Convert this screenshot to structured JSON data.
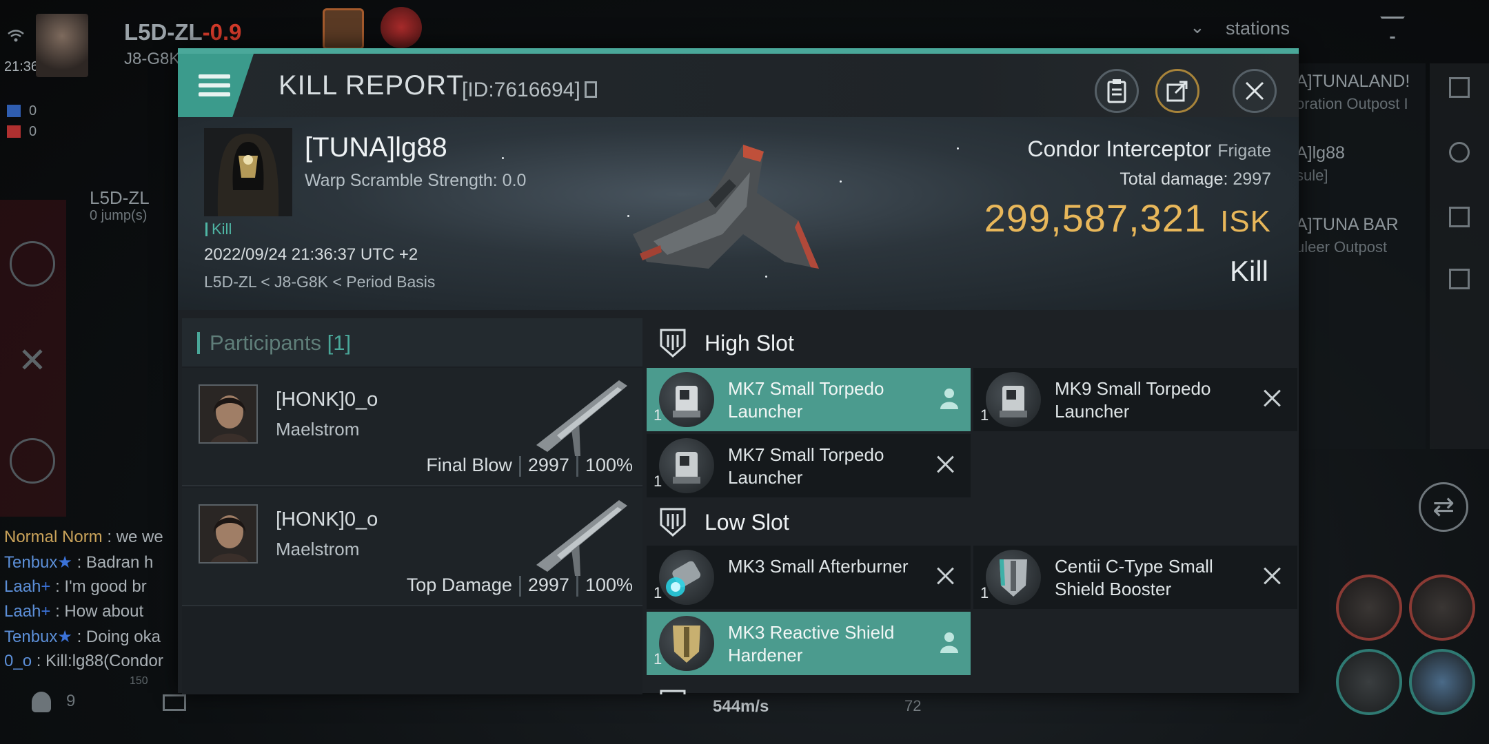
{
  "hud": {
    "system_name": "L5D-ZL",
    "security": "-0.9",
    "constellation": "J8-G8K",
    "time": "21:36",
    "flag_count_blue": "0",
    "flag_count_red": "0",
    "local_system": "L5D-ZL",
    "jumps": "0 jump(s)",
    "stations_label": "stations",
    "nearby_1_title": "A]TUNALAND!",
    "nearby_1_sub": "oration Outpost I",
    "nearby_2_title": "A]lg88",
    "nearby_2_sub": "sule]",
    "nearby_3_title": "A]TUNA BAR",
    "nearby_3_sub": "uleer Outpost",
    "speed": "544m/s",
    "speed_scale": "150",
    "speed_value_2": "72",
    "member_count": "9"
  },
  "chat": [
    {
      "name": "Normal Norm",
      "text": " : we we"
    },
    {
      "name": "Tenbux",
      "badge": "★",
      "text": " : Badran h"
    },
    {
      "name": "Laah",
      "badge": "+",
      "text": " : I'm good br"
    },
    {
      "name": "Laah",
      "badge": "+",
      "text": " : How about "
    },
    {
      "name": "Tenbux",
      "badge": "★",
      "text": " : Doing oka"
    },
    {
      "name": "0_o",
      "text": " : Kill:lg88(Condor"
    }
  ],
  "modal": {
    "title": "KILL REPORT",
    "report_id": "[ID:7616694]",
    "victim": {
      "name": "[TUNA]lg88",
      "warp_scramble": "Warp Scramble Strength: 0.0",
      "tag": "Kill",
      "datetime": "2022/09/24 21:36:37 UTC +2",
      "location": "L5D-ZL < J8-G8K < Period Basis"
    },
    "ship": {
      "name": "Condor Interceptor",
      "class": "Frigate",
      "total_damage_label": "Total damage:",
      "total_damage": "2997",
      "isk_value": "299,587,321",
      "isk_unit": "ISK",
      "result": "Kill"
    },
    "participants": {
      "label": "Participants",
      "count": "[1]",
      "rows": [
        {
          "name": "[HONK]0_o",
          "ship": "Maelstrom",
          "role": "Final Blow",
          "damage": "2997",
          "percent": "100%"
        },
        {
          "name": "[HONK]0_o",
          "ship": "Maelstrom",
          "role": "Top Damage",
          "damage": "2997",
          "percent": "100%"
        }
      ]
    },
    "slots": {
      "high_label": "High Slot",
      "low_label": "Low Slot",
      "high": [
        {
          "name": "MK7 Small Torpedo Launcher",
          "qty": "1",
          "state": "fitted"
        },
        {
          "name": "MK9 Small Torpedo Launcher",
          "qty": "1",
          "state": "destroyed"
        },
        {
          "name": "MK7 Small Torpedo Launcher",
          "qty": "1",
          "state": "destroyed"
        }
      ],
      "low": [
        {
          "name": "MK3 Small Afterburner",
          "qty": "1",
          "state": "destroyed"
        },
        {
          "name": "Centii C-Type Small Shield Booster",
          "qty": "1",
          "state": "destroyed"
        },
        {
          "name": "MK3 Reactive Shield Hardener",
          "qty": "1",
          "state": "fitted"
        }
      ]
    }
  },
  "colors": {
    "accent": "#4aa89a",
    "isk": "#e8b75a",
    "security_red": "#d23a2a"
  }
}
